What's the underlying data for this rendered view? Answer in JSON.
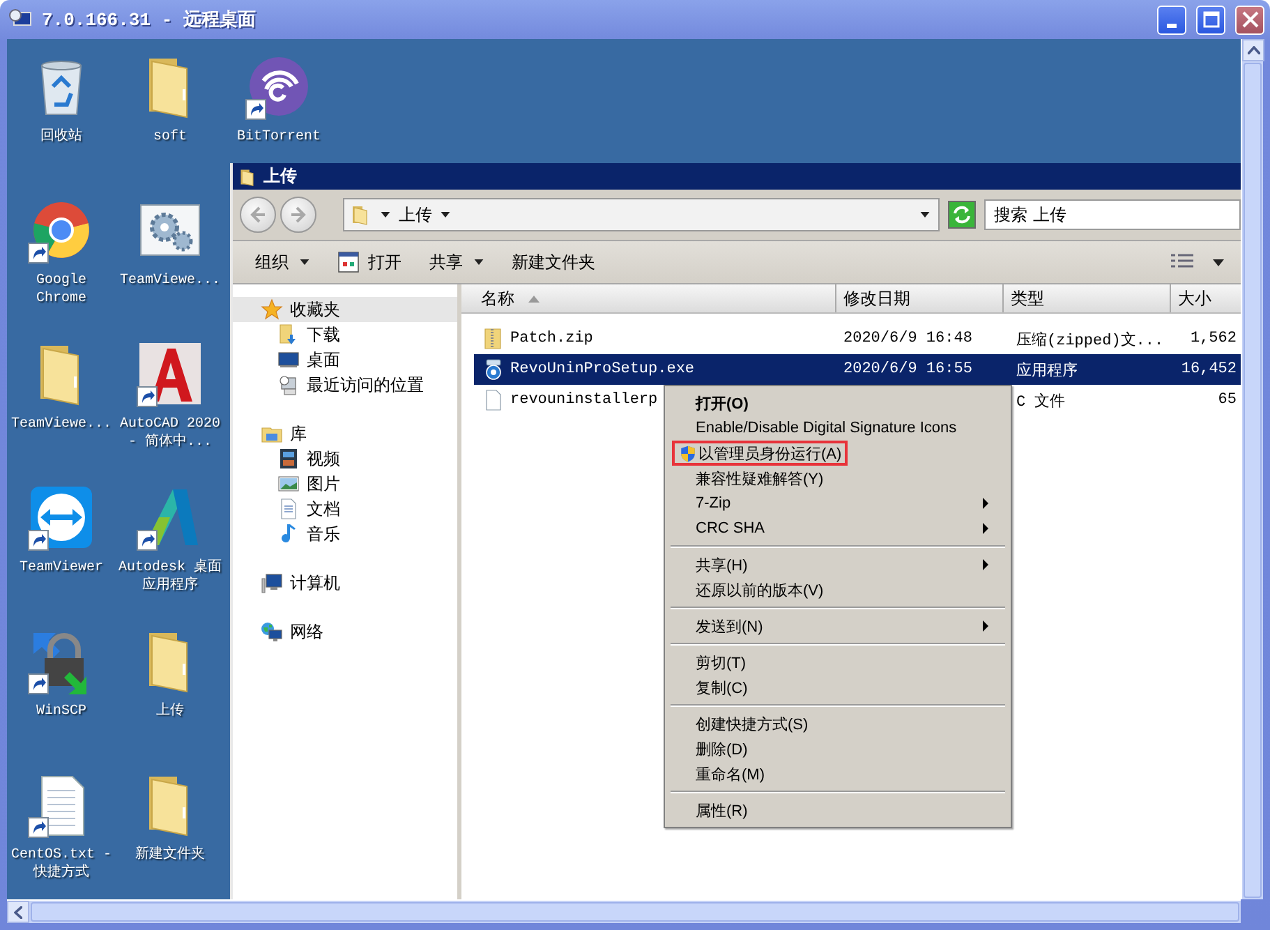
{
  "window": {
    "title": "7.0.166.31 - 远程桌面"
  },
  "desktop_icons": [
    {
      "label": "回收站",
      "kind": "recycle-bin",
      "shortcut": false
    },
    {
      "label": "Google Chrome",
      "kind": "chrome",
      "shortcut": true
    },
    {
      "label": "TeamViewe...",
      "kind": "folder",
      "shortcut": false
    },
    {
      "label": "TeamViewer",
      "kind": "teamviewer",
      "shortcut": true
    },
    {
      "label": "WinSCP",
      "kind": "winscp",
      "shortcut": true
    },
    {
      "label": "CentOS.txt - 快捷方式",
      "kind": "text-file",
      "shortcut": true
    },
    {
      "label": "soft",
      "kind": "folder",
      "shortcut": false
    },
    {
      "label": "TeamViewe...",
      "kind": "gear-window",
      "shortcut": false
    },
    {
      "label": "AutoCAD 2020 - 简体中...",
      "kind": "autocad",
      "shortcut": true
    },
    {
      "label": "Autodesk 桌面应用程序",
      "kind": "autodesk",
      "shortcut": true
    },
    {
      "label": "上传",
      "kind": "folder",
      "shortcut": false
    },
    {
      "label": "新建文件夹",
      "kind": "folder",
      "shortcut": false
    },
    {
      "label": "BitTorrent",
      "kind": "bittorrent",
      "shortcut": true
    }
  ],
  "explorer": {
    "title": "上传",
    "nav_buttons": [
      {
        "kind": "back",
        "disabled": true
      },
      {
        "kind": "forward",
        "disabled": true
      }
    ],
    "breadcrumb": "上传",
    "search_placeholder": "搜索 上传",
    "toolbar": [
      {
        "label": "组织",
        "kind": "menu"
      },
      {
        "label": "打开",
        "kind": "open"
      },
      {
        "label": "共享",
        "kind": "menu"
      },
      {
        "label": "新建文件夹",
        "kind": "plain"
      }
    ],
    "navigation": [
      {
        "label": "收藏夹",
        "kind": "favorites",
        "selected": true,
        "children": [
          {
            "label": "下载",
            "kind": "downloads",
            "selected": false
          },
          {
            "label": "桌面",
            "kind": "desktop",
            "selected": false
          },
          {
            "label": "最近访问的位置",
            "kind": "recent",
            "selected": false
          }
        ]
      },
      {
        "label": "库",
        "kind": "library",
        "selected": false,
        "children": [
          {
            "label": "视频",
            "kind": "video",
            "selected": false
          },
          {
            "label": "图片",
            "kind": "pictures",
            "selected": false
          },
          {
            "label": "文档",
            "kind": "documents",
            "selected": false
          },
          {
            "label": "音乐",
            "kind": "music",
            "selected": false
          }
        ]
      },
      {
        "label": "计算机",
        "kind": "computer",
        "selected": false
      },
      {
        "label": "网络",
        "kind": "network",
        "selected": false
      }
    ],
    "columns": [
      {
        "label": "名称",
        "sorted": true
      },
      {
        "label": "修改日期",
        "sorted": false
      },
      {
        "label": "类型",
        "sorted": false
      },
      {
        "label": "大小",
        "sorted": false
      }
    ],
    "rows": [
      {
        "name": "Patch.zip",
        "kind": "zip",
        "date": "2020/6/9 16:48",
        "type": "压缩(zipped)文...",
        "size": "1,562",
        "selected": false
      },
      {
        "name": "RevoUninProSetup.exe",
        "kind": "installer",
        "date": "2020/6/9 16:55",
        "type": "应用程序",
        "size": "16,452",
        "selected": true
      },
      {
        "name": "revouninstallerp",
        "kind": "file",
        "type": "C 文件",
        "size": "65",
        "selected": false
      }
    ]
  },
  "context_menu": {
    "items": [
      {
        "kind": "item",
        "label": "打开(O)",
        "default": true,
        "submenu": false,
        "highlighted": false
      },
      {
        "kind": "item",
        "label": "Enable/Disable Digital Signature Icons",
        "default": false,
        "submenu": false,
        "highlighted": false
      },
      {
        "kind": "admin-item",
        "label": "以管理员身份运行(A)",
        "default": false,
        "submenu": false,
        "highlighted": true
      },
      {
        "kind": "item",
        "label": "兼容性疑难解答(Y)",
        "default": false,
        "submenu": false,
        "highlighted": false
      },
      {
        "kind": "item",
        "label": "7-Zip",
        "default": false,
        "submenu": true,
        "highlighted": false
      },
      {
        "kind": "item",
        "label": "CRC SHA",
        "default": false,
        "submenu": true,
        "highlighted": false
      },
      {
        "kind": "separator"
      },
      {
        "kind": "item",
        "label": "共享(H)",
        "default": false,
        "submenu": true,
        "highlighted": false
      },
      {
        "kind": "item",
        "label": "还原以前的版本(V)",
        "default": false,
        "submenu": false,
        "highlighted": false
      },
      {
        "kind": "separator"
      },
      {
        "kind": "item",
        "label": "发送到(N)",
        "default": false,
        "submenu": true,
        "highlighted": false
      },
      {
        "kind": "separator"
      },
      {
        "kind": "item",
        "label": "剪切(T)",
        "default": false,
        "submenu": false,
        "highlighted": false
      },
      {
        "kind": "item",
        "label": "复制(C)",
        "default": false,
        "submenu": false,
        "highlighted": false
      },
      {
        "kind": "separator"
      },
      {
        "kind": "item",
        "label": "创建快捷方式(S)",
        "default": false,
        "submenu": false,
        "highlighted": false
      },
      {
        "kind": "item",
        "label": "删除(D)",
        "default": false,
        "submenu": false,
        "highlighted": false
      },
      {
        "kind": "item",
        "label": "重命名(M)",
        "default": false,
        "submenu": false,
        "highlighted": false
      },
      {
        "kind": "separator"
      },
      {
        "kind": "item",
        "label": "属性(R)",
        "default": false,
        "submenu": false,
        "highlighted": false
      }
    ]
  }
}
